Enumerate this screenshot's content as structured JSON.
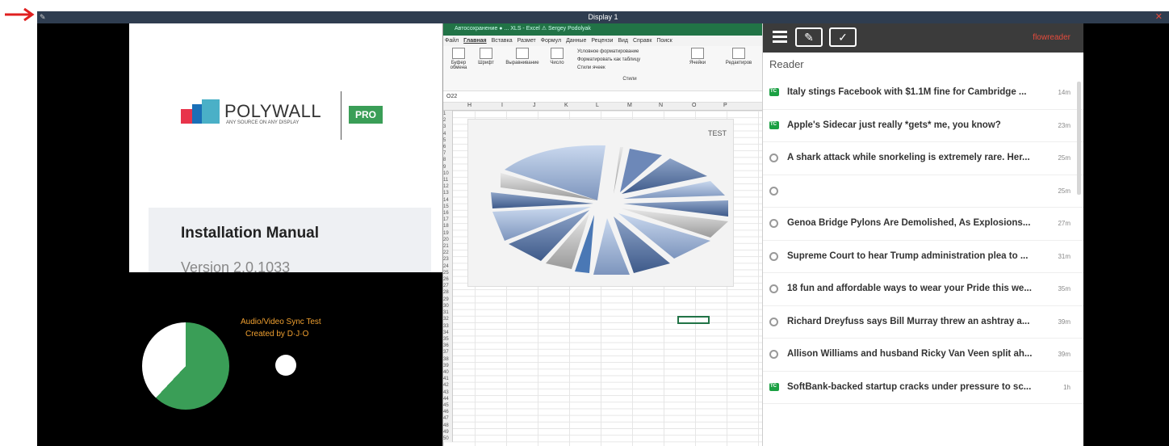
{
  "window": {
    "title": "Display 1",
    "close_icon": "close-icon",
    "edit_icon": "pencil-icon"
  },
  "doc": {
    "brand": "POLYWALL",
    "tagline": "ANY SOURCE ON ANY DISPLAY",
    "pro": "PRO",
    "heading": "Installation Manual",
    "version": "Version 2.0.1033"
  },
  "av": {
    "line1": "Audio/Video Sync Test",
    "line2": "Created by D·J·O"
  },
  "excel": {
    "title": "Автосохранение  ●  ...  XLS - Excel   ⚠ Sergey Podolyak",
    "menu": [
      "Файл",
      "Главная",
      "Вставка",
      "Размет",
      "Формул",
      "Данные",
      "Рецензи",
      "Вид",
      "Справк",
      "Поиск"
    ],
    "ribbon": {
      "clipboard": "Буфер обмена",
      "font": "Шрифт",
      "align": "Выравнивание",
      "number": "Число",
      "cond": "Условное форматирование",
      "table": "Форматировать как таблицу",
      "styles_item": "Стили ячеек",
      "styles": "Стили",
      "cells": "Ячейки",
      "edit": "Редактиров"
    },
    "namebox": "O22",
    "columns": [
      "H",
      "I",
      "J",
      "K",
      "L",
      "M",
      "N",
      "O",
      "P"
    ],
    "chart_title": "TEST"
  },
  "reader": {
    "header": "Reader",
    "brand": "flowreader",
    "items": [
      {
        "title": "Italy stings Facebook with $1.1M fine for Cambridge ...",
        "time": "14m",
        "icon": "tc"
      },
      {
        "title": "Apple's Sidecar just really *gets* me, you know?",
        "time": "23m",
        "icon": "tc"
      },
      {
        "title": "A shark attack while snorkeling is extremely rare. Her...",
        "time": "25m",
        "icon": "globe"
      },
      {
        "title": "",
        "time": "25m",
        "icon": "globe"
      },
      {
        "title": "Genoa Bridge Pylons Are Demolished, As Explosions...",
        "time": "27m",
        "icon": "globe"
      },
      {
        "title": "Supreme Court to hear Trump administration plea to ...",
        "time": "31m",
        "icon": "globe"
      },
      {
        "title": "18 fun and affordable ways to wear your Pride this we...",
        "time": "35m",
        "icon": "globe"
      },
      {
        "title": "Richard Dreyfuss says Bill Murray threw an ashtray a...",
        "time": "39m",
        "icon": "globe"
      },
      {
        "title": "Allison Williams and husband Ricky Van Veen split ah...",
        "time": "39m",
        "icon": "globe"
      },
      {
        "title": "SoftBank-backed startup cracks under pressure to sc...",
        "time": "1h",
        "icon": "tc"
      }
    ]
  }
}
